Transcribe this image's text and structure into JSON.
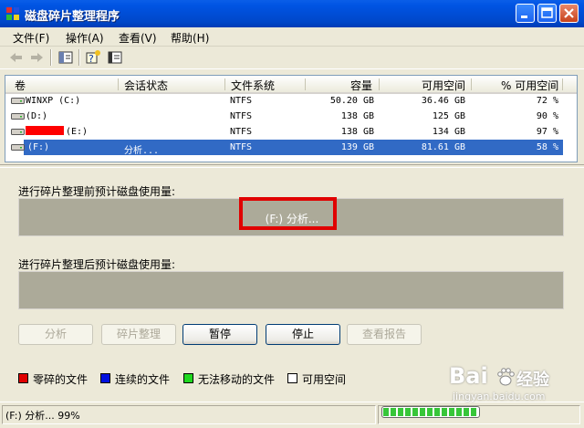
{
  "window": {
    "title": "磁盘碎片整理程序"
  },
  "menu": [
    "文件(F)",
    "操作(A)",
    "查看(V)",
    "帮助(H)"
  ],
  "columns": [
    "卷",
    "会话状态",
    "文件系统",
    "容量",
    "可用空间",
    "% 可用空间"
  ],
  "rows": [
    {
      "volume": "WINXP (C:)",
      "status": "",
      "fs": "NTFS",
      "capacity": "50.20 GB",
      "free": "36.46 GB",
      "pct": "72 %"
    },
    {
      "volume": "(D:)",
      "status": "",
      "fs": "NTFS",
      "capacity": "138 GB",
      "free": "125 GB",
      "pct": "90 %"
    },
    {
      "volume": "(E:)",
      "status": "",
      "fs": "NTFS",
      "capacity": "138 GB",
      "free": "134 GB",
      "pct": "97 %"
    },
    {
      "volume": "(F:)",
      "status": "分析...",
      "fs": "NTFS",
      "capacity": "139 GB",
      "free": "81.61 GB",
      "pct": "58 %"
    }
  ],
  "before_label": "进行碎片整理前预计磁盘使用量:",
  "before_text": "(F:) 分析...",
  "after_label": "进行碎片整理后预计磁盘使用量:",
  "buttons": {
    "analyze": "分析",
    "defrag": "碎片整理",
    "pause": "暂停",
    "stop": "停止",
    "report": "查看报告"
  },
  "legend": [
    {
      "label": "零碎的文件",
      "color": "#e00000"
    },
    {
      "label": "连续的文件",
      "color": "#0010e0"
    },
    {
      "label": "无法移动的文件",
      "color": "#20d820"
    },
    {
      "label": "可用空间",
      "color": "#ffffff"
    }
  ],
  "status": {
    "text": "(F:) 分析... 99%",
    "progress": 0.99
  },
  "watermark": {
    "brand": "Bai",
    "brand2": "经验",
    "url": "jingyan.baidu.com"
  }
}
